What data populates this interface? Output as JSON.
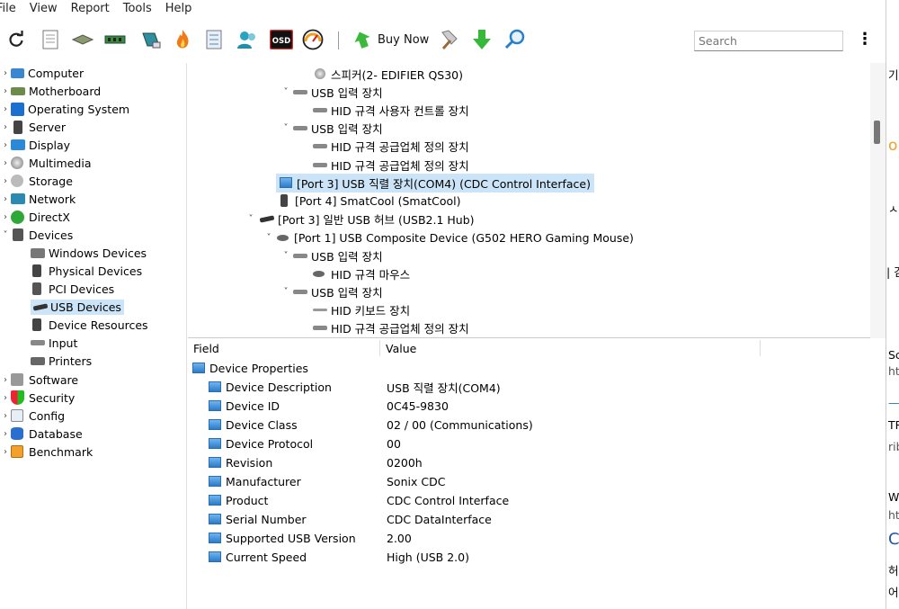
{
  "menu": [
    "File",
    "View",
    "Report",
    "Tools",
    "Help"
  ],
  "toolbar": {
    "buy_now": "Buy Now",
    "search_placeholder": "Search",
    "osd_label": "OSD"
  },
  "left_tree": {
    "computer": "Computer",
    "motherboard": "Motherboard",
    "operating_system": "Operating System",
    "server": "Server",
    "display": "Display",
    "multimedia": "Multimedia",
    "storage": "Storage",
    "network": "Network",
    "directx": "DirectX",
    "devices": "Devices",
    "windows_devices": "Windows Devices",
    "physical_devices": "Physical Devices",
    "pci_devices": "PCI Devices",
    "usb_devices": "USB Devices",
    "device_resources": "Device Resources",
    "input": "Input",
    "printers": "Printers",
    "software": "Software",
    "security": "Security",
    "config": "Config",
    "database": "Database",
    "benchmark": "Benchmark"
  },
  "usb_tree": {
    "r0": "스피커(2- EDIFIER QS30)",
    "r1": "USB 입력 장치",
    "r2": "HID 규격 사용자 컨트롤 장치",
    "r3": "USB 입력 장치",
    "r4": "HID 규격 공급업체 정의 장치",
    "r5": "HID 규격 공급업체 정의 장치",
    "r6": "[Port 3] USB 직렬 장치(COM4) (CDC Control Interface)",
    "r7": "[Port 4] SmatCool (SmatCool)",
    "r8": "[Port 3] 일반 USB 허브 (USB2.1 Hub)",
    "r9": "[Port 1] USB Composite Device (G502 HERO Gaming Mouse)",
    "r10": "USB 입력 장치",
    "r11": "HID 규격 마우스",
    "r12": "USB 입력 장치",
    "r13": "HID 키보드 장치",
    "r14": "HID 규격 공급업체 정의 장치"
  },
  "grid": {
    "col_field": "Field",
    "col_value": "Value",
    "group": "Device Properties",
    "rows": [
      {
        "field": "Device Description",
        "value": "USB 직렬 장치(COM4)"
      },
      {
        "field": "Device ID",
        "value": "0C45-9830"
      },
      {
        "field": "Device Class",
        "value": "02 / 00 (Communications)"
      },
      {
        "field": "Device Protocol",
        "value": "00"
      },
      {
        "field": "Revision",
        "value": "0200h"
      },
      {
        "field": "Manufacturer",
        "value": "Sonix CDC"
      },
      {
        "field": "Product",
        "value": "CDC Control Interface"
      },
      {
        "field": "Serial Number",
        "value": "CDC DataInterface"
      },
      {
        "field": "Supported USB Version",
        "value": "2.00"
      },
      {
        "field": "Current Speed",
        "value": "High  (USB 2.0)"
      }
    ]
  },
  "sliver": [
    "기",
    "o",
    "ㅅ",
    "| 검",
    "Sc",
    "http",
    "—",
    "TR",
    "rib",
    "Wi",
    "http",
    "C",
    "허",
    "어-"
  ]
}
